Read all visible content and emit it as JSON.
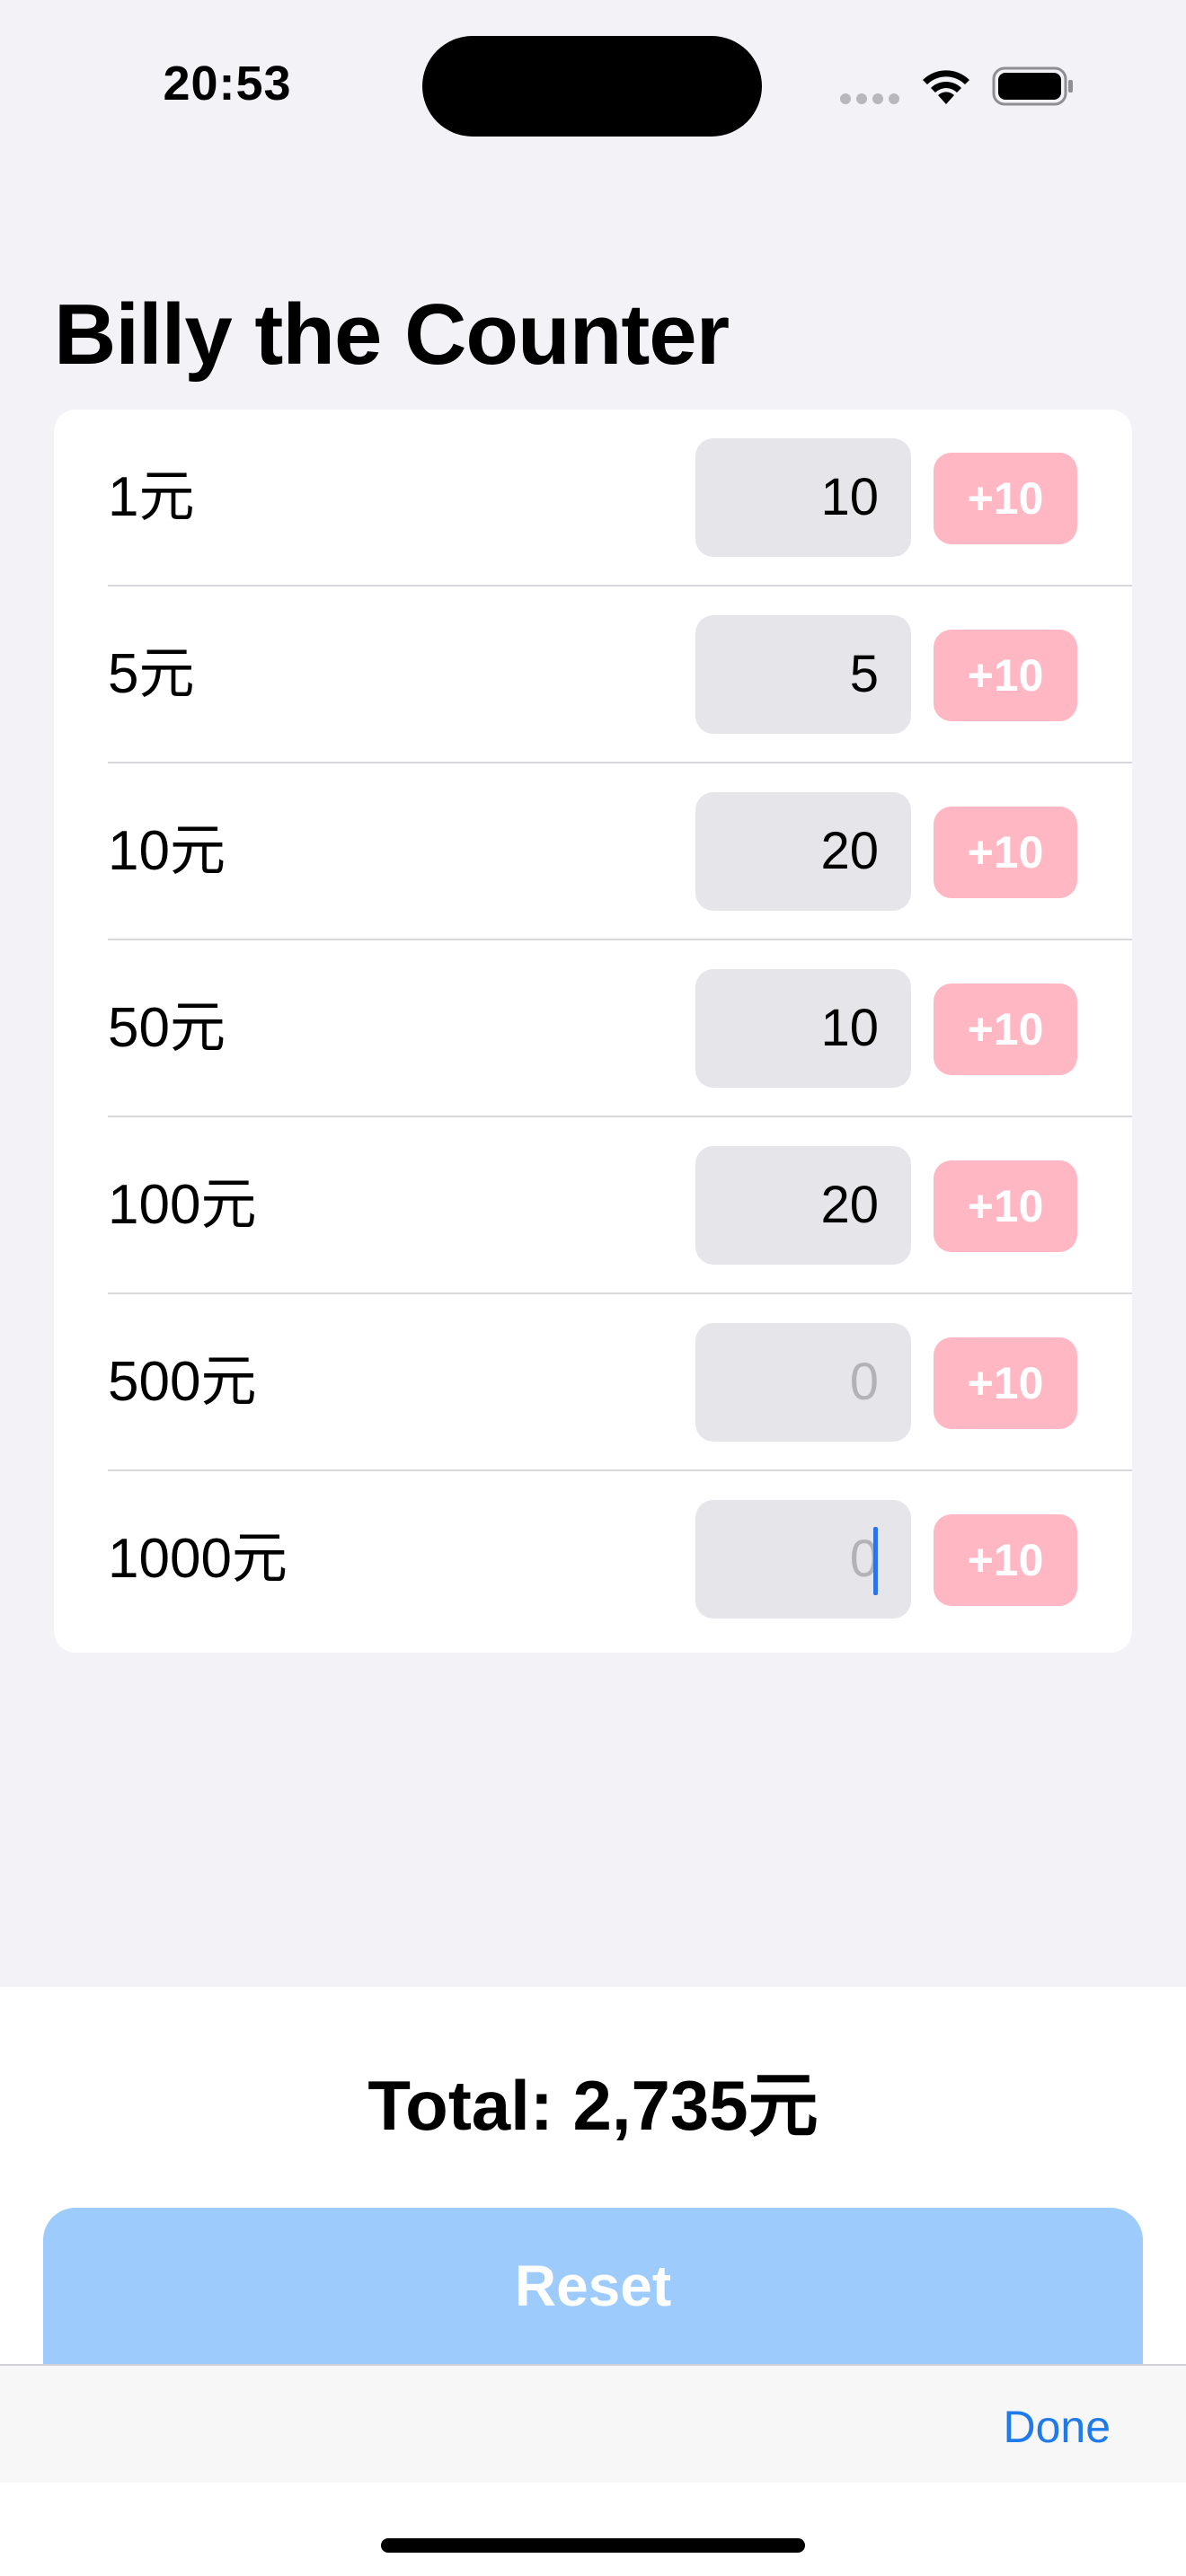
{
  "status_bar": {
    "time": "20:53"
  },
  "title": "Billy the Counter",
  "rows": [
    {
      "label": "1元",
      "value": "10",
      "button": "+10",
      "is_placeholder": false
    },
    {
      "label": "5元",
      "value": "5",
      "button": "+10",
      "is_placeholder": false
    },
    {
      "label": "10元",
      "value": "20",
      "button": "+10",
      "is_placeholder": false
    },
    {
      "label": "50元",
      "value": "10",
      "button": "+10",
      "is_placeholder": false
    },
    {
      "label": "100元",
      "value": "20",
      "button": "+10",
      "is_placeholder": false
    },
    {
      "label": "500元",
      "value": "0",
      "button": "+10",
      "is_placeholder": true
    },
    {
      "label": "1000元",
      "value": "0",
      "button": "+10",
      "is_placeholder": true,
      "focused": true
    }
  ],
  "total_text": "Total: 2,735元",
  "reset_label": "Reset",
  "toolbar": {
    "done_label": "Done"
  },
  "colors": {
    "background": "#f2f2f7",
    "add_button": "#ffb7c4",
    "reset_button": "#9ccbfc",
    "done_link": "#1f7aea",
    "cursor": "#2b73e6"
  },
  "icons": [
    "cellular-signal-icon",
    "wifi-icon",
    "battery-icon"
  ]
}
